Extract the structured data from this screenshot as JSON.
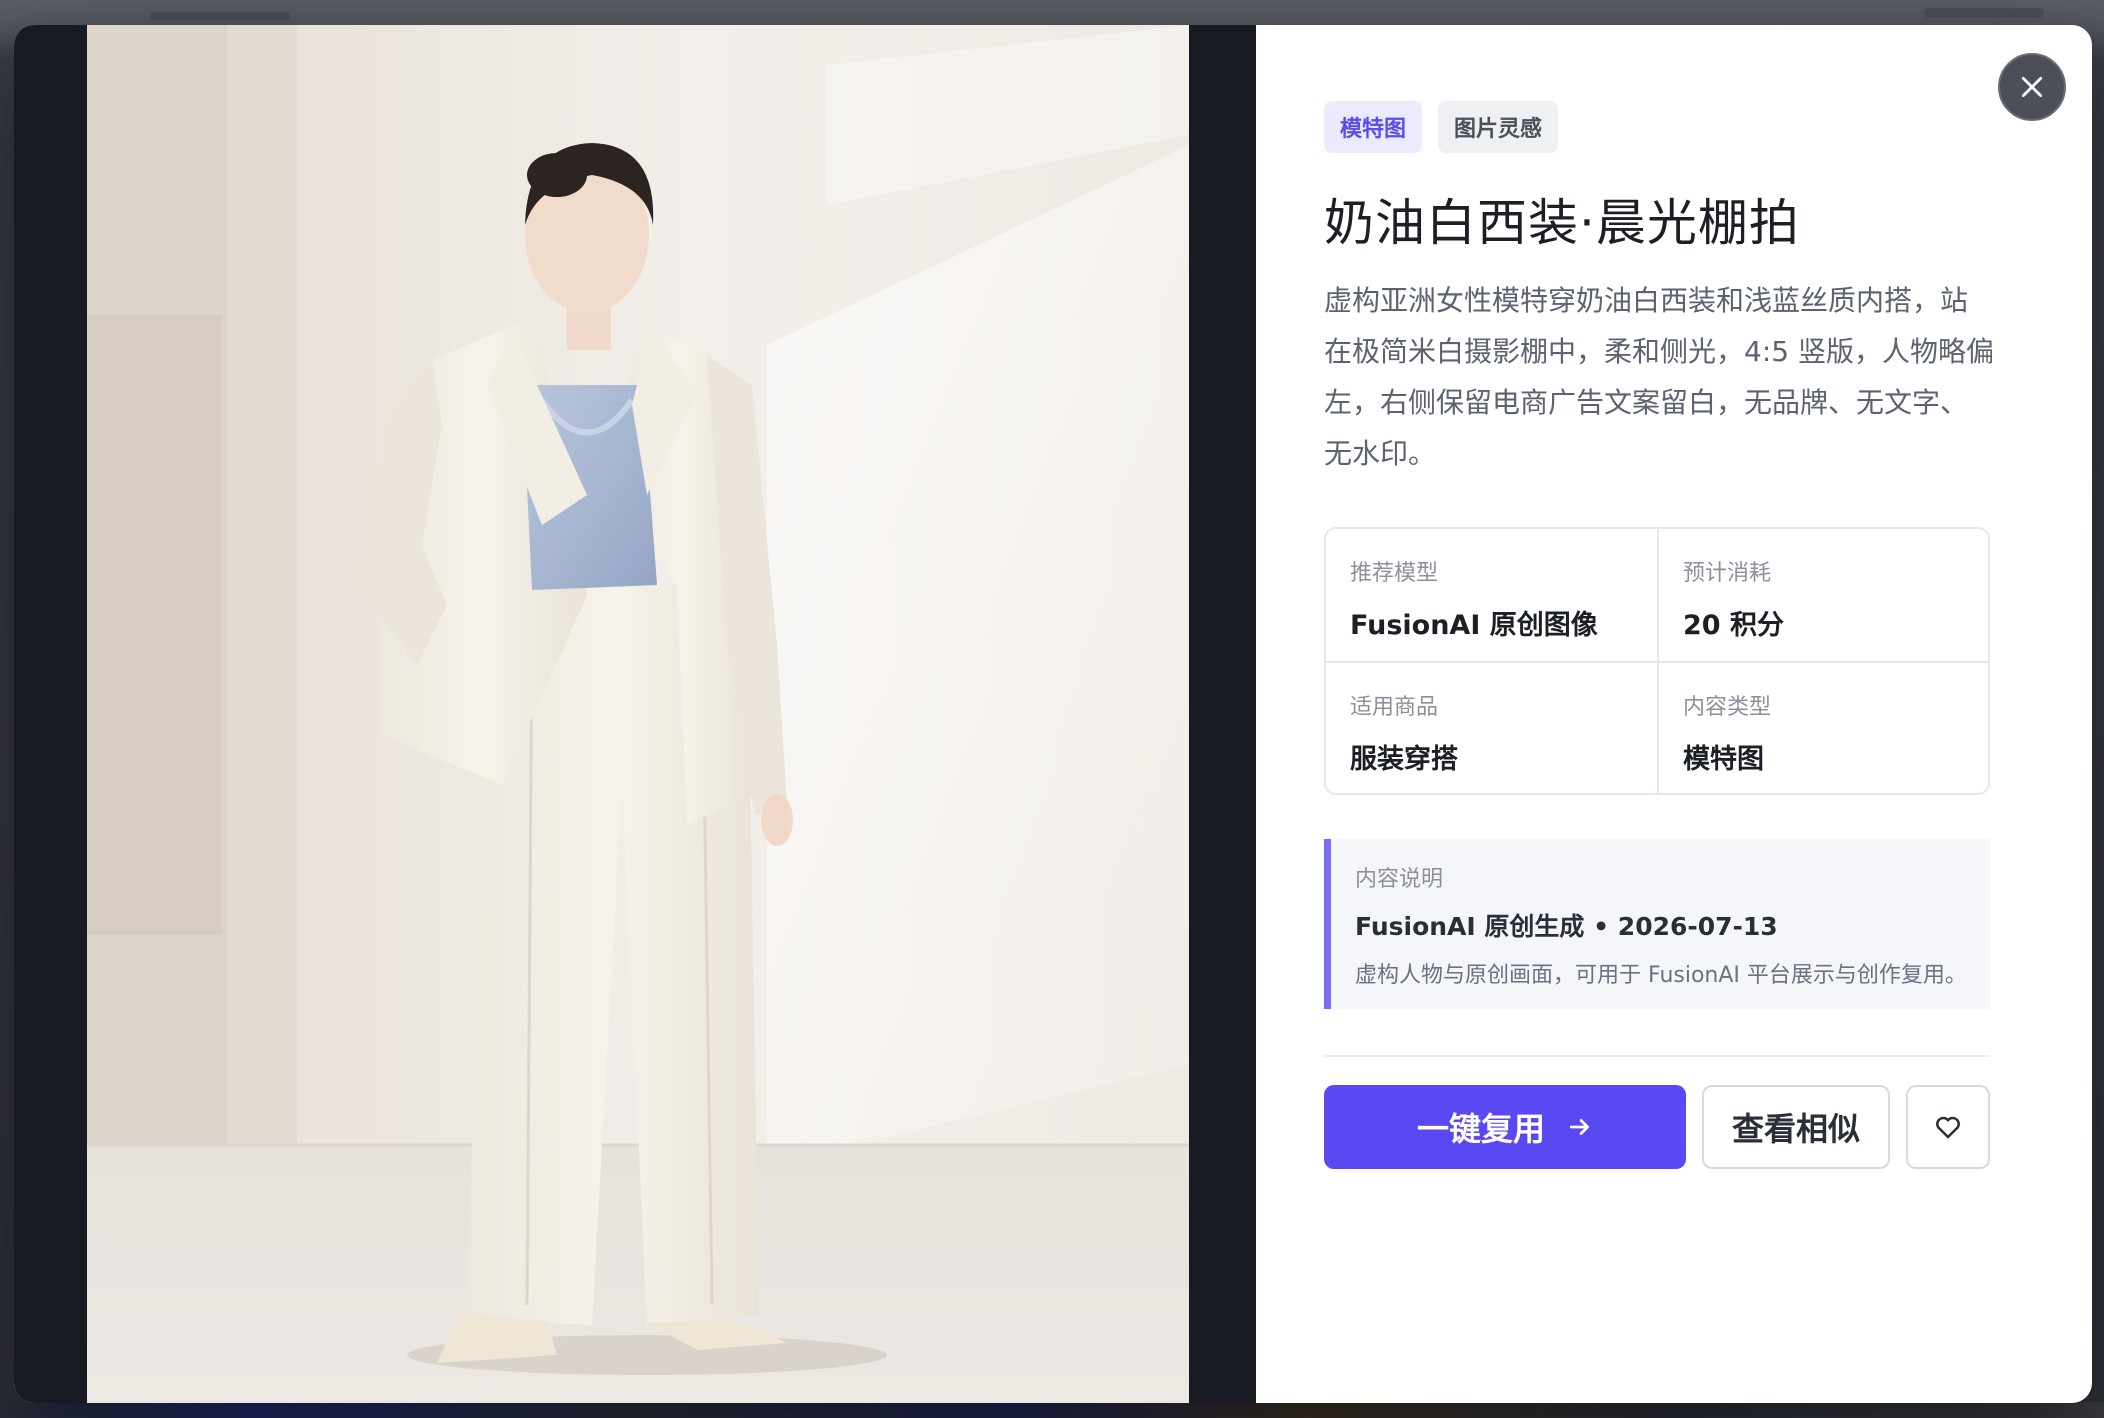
{
  "modal": {
    "close_icon": "close-icon",
    "tags": [
      {
        "label": "模特图",
        "style": "primary"
      },
      {
        "label": "图片灵感",
        "style": "secondary"
      }
    ],
    "title": "奶油白西装·晨光棚拍",
    "description": "虚构亚洲女性模特穿奶油白西装和浅蓝丝质内搭，站在极简米白摄影棚中，柔和侧光，4:5 竖版，人物略偏左，右侧保留电商广告文案留白，无品牌、无文字、无水印。",
    "specs": [
      {
        "label": "推荐模型",
        "value": "FusionAI 原创图像"
      },
      {
        "label": "预计消耗",
        "value": "20 积分"
      },
      {
        "label": "适用商品",
        "value": "服装穿搭"
      },
      {
        "label": "内容类型",
        "value": "模特图"
      }
    ],
    "note": {
      "label": "内容说明",
      "title": "FusionAI 原创生成 • 2026-07-13",
      "text": "虚构人物与原创画面，可用于 FusionAI 平台展示与创作复用。"
    },
    "actions": {
      "reuse_label": "一键复用",
      "reuse_icon": "arrow-right-icon",
      "similar_label": "查看相似",
      "favorite_icon": "heart-icon"
    }
  },
  "colors": {
    "accent": "#5a48f2",
    "tag_primary_bg": "#eceaff",
    "tag_primary_text": "#5b4cf0",
    "note_border": "#7b6cf4"
  }
}
